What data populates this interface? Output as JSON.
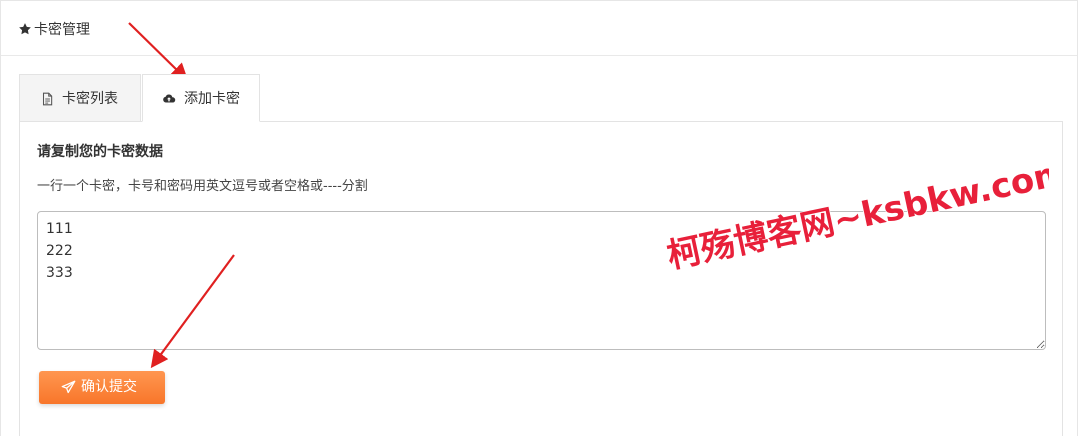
{
  "header": {
    "icon": "star-icon",
    "title": "卡密管理"
  },
  "tabs": [
    {
      "label": "卡密列表",
      "icon": "file-text-icon",
      "active": false
    },
    {
      "label": "添加卡密",
      "icon": "cloud-upload-icon",
      "active": true
    }
  ],
  "form": {
    "heading": "请复制您的卡密数据",
    "hint": "一行一个卡密，卡号和密码用英文逗号或者空格或----分割",
    "textarea_value": "111\n222\n333",
    "submit_label": "确认提交",
    "submit_icon": "paper-plane-icon"
  },
  "watermark": {
    "text": "柯殇博客网~ksbkw.com",
    "color": "#e8203a"
  },
  "colors": {
    "accent_orange": "#f8762a",
    "annotation_red": "#e02020"
  }
}
